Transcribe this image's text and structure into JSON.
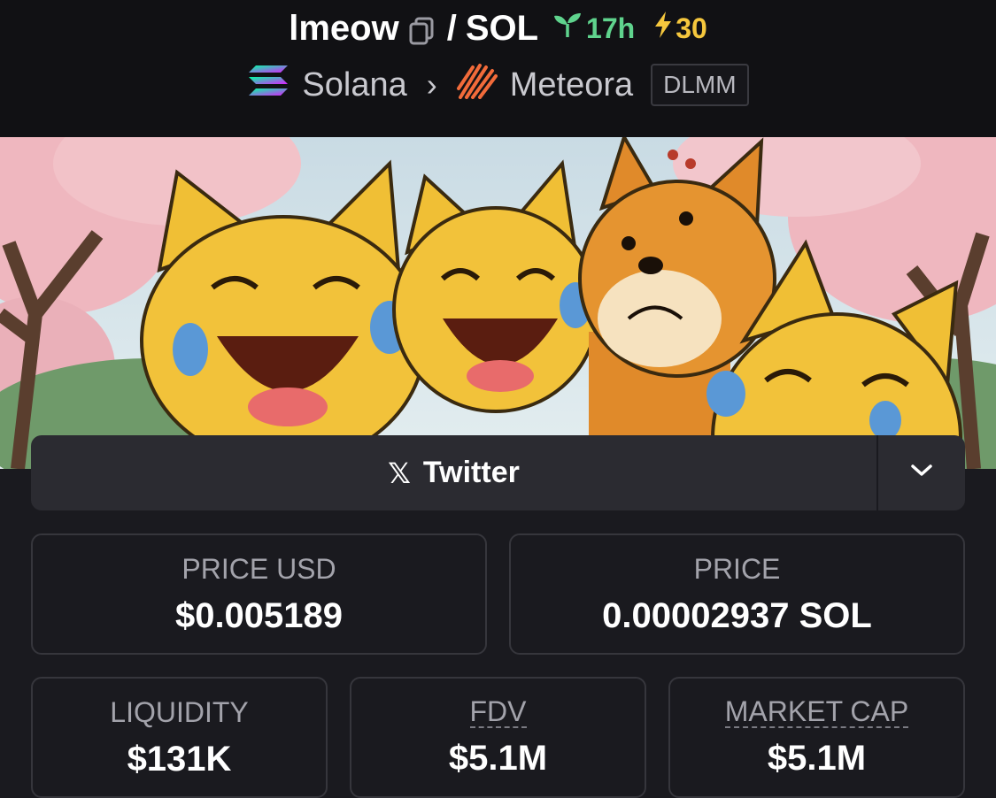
{
  "header": {
    "token": "lmeow",
    "separator": "/",
    "quote": "SOL",
    "age": "17h",
    "boosts": "30",
    "chain": "Solana",
    "dex": "Meteora",
    "pool_type": "DLMM",
    "icons": {
      "copy": "copy-icon",
      "age": "seedling-icon",
      "boost": "lightning-icon",
      "chain": "solana-logo",
      "dex": "meteora-logo"
    },
    "colors": {
      "age": "#5fd38d",
      "boost": "#f5c73d"
    }
  },
  "banner": {
    "image": "cartoon cats and shiba dog banner"
  },
  "social": {
    "twitter_label": "Twitter",
    "x_glyph": "𝕏",
    "dropdown_icon": "chevron-down-icon"
  },
  "stats": {
    "price_usd": {
      "label": "PRICE USD",
      "value": "$0.005189"
    },
    "price": {
      "label": "PRICE",
      "value": "0.00002937 SOL"
    },
    "liquidity": {
      "label": "LIQUIDITY",
      "value": "$131K"
    },
    "fdv": {
      "label": "FDV",
      "value": "$5.1M"
    },
    "market_cap": {
      "label": "MARKET CAP",
      "value": "$5.1M"
    }
  }
}
